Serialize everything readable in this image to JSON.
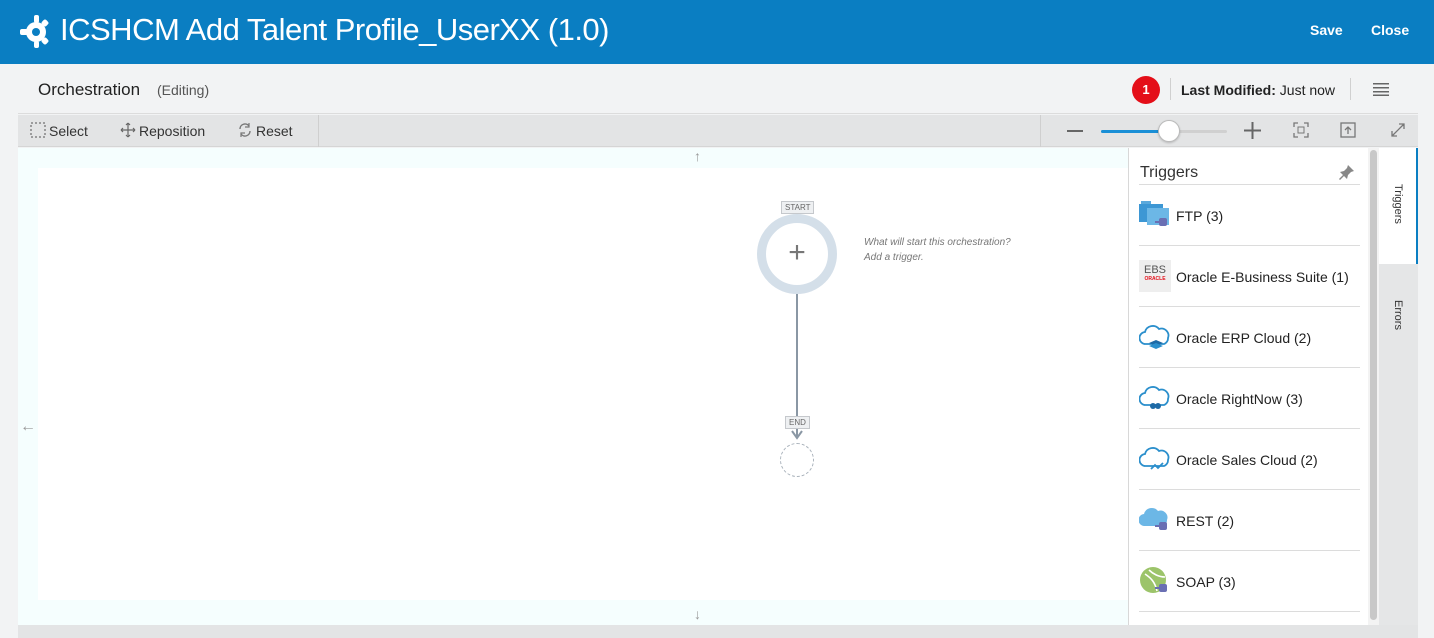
{
  "header": {
    "title": "ICSHCM Add Talent Profile_UserXX (1.0)",
    "save_label": "Save",
    "close_label": "Close",
    "bg_color": "#0a7ec2"
  },
  "subheader": {
    "title": "Orchestration",
    "mode": "(Editing)",
    "badge_count": "1",
    "last_modified_label": "Last Modified:",
    "last_modified_value": "Just now"
  },
  "toolbar": {
    "select_label": "Select",
    "reposition_label": "Reposition",
    "reset_label": "Reset",
    "zoom_level": 0.54
  },
  "canvas": {
    "start_label": "START",
    "end_label": "END",
    "hint_line1": "What will start this orchestration?",
    "hint_line2": "Add a trigger."
  },
  "palette": {
    "title": "Triggers",
    "items": [
      {
        "label": "FTP (3)",
        "icon": "ftp-icon"
      },
      {
        "label": "Oracle E-Business Suite (1)",
        "icon": "ebs-icon"
      },
      {
        "label": "Oracle ERP Cloud (2)",
        "icon": "erp-cloud-icon"
      },
      {
        "label": "Oracle RightNow (3)",
        "icon": "rightnow-cloud-icon"
      },
      {
        "label": "Oracle Sales Cloud (2)",
        "icon": "sales-cloud-icon"
      },
      {
        "label": "REST (2)",
        "icon": "rest-icon"
      },
      {
        "label": "SOAP (3)",
        "icon": "soap-icon"
      }
    ],
    "ebs_text": "EBS",
    "ebs_sub": "ORACLE"
  },
  "sidetabs": {
    "triggers_label": "Triggers",
    "errors_label": "Errors"
  }
}
